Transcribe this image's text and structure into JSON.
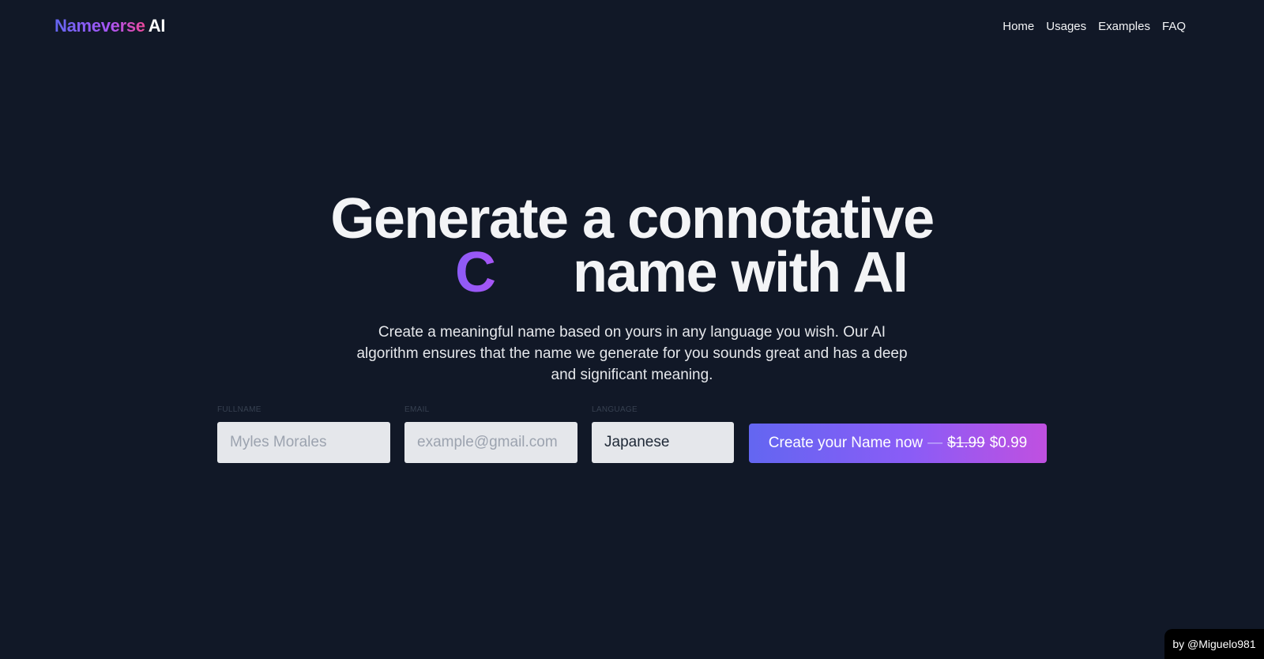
{
  "header": {
    "logo_brand": "Nameverse",
    "logo_suffix": "AI",
    "nav": [
      "Home",
      "Usages",
      "Examples",
      "FAQ"
    ]
  },
  "hero": {
    "title_line1": "Generate a connotative",
    "typed_text": "C",
    "title_line2": "name with AI",
    "subtitle": "Create a meaningful name based on yours in any language you wish. Our AI algorithm ensures that the name we generate for you sounds great and has a deep and significant meaning."
  },
  "form": {
    "fullname": {
      "label": "FULLNAME",
      "placeholder": "Myles Morales",
      "value": ""
    },
    "email": {
      "label": "EMAIL",
      "placeholder": "example@gmail.com",
      "value": ""
    },
    "language": {
      "label": "LANGUAGE",
      "placeholder": "",
      "value": "Japanese"
    },
    "cta": {
      "label": "Create your Name now",
      "separator": "—",
      "old_price": "$1.99",
      "new_price": "$0.99"
    }
  },
  "footer": {
    "credit": "by @Miguelo981"
  },
  "colors": {
    "background": "#111827",
    "accent_start": "#6366f1",
    "accent_end": "#c050e0"
  }
}
